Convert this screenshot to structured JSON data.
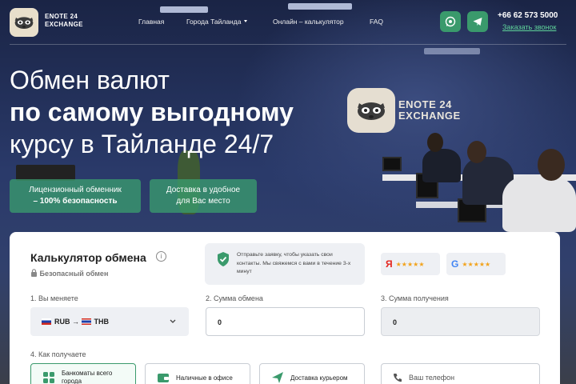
{
  "header": {
    "logo_text_line1": "ENOTE 24",
    "logo_text_line2": "EXCHANGE",
    "nav": {
      "home": "Главная",
      "cities": "Города Тайланда",
      "calculator": "Онлайн – калькулятор",
      "faq": "FAQ"
    },
    "phone": "+66 62 573 5000",
    "callback": "Заказать звонок"
  },
  "background": {
    "wall_logo_line1": "ENOTE 24",
    "wall_logo_line2": "EXCHANGE"
  },
  "hero": {
    "title_line1": "Обмен валют",
    "title_line2": "по самому выгодному",
    "title_line3": "курсу в Тайланде 24/7",
    "btn1_line1": "Лицензионный обменник",
    "btn1_line2": "– 100% безопасность",
    "btn2_line1": "Доставка в удобное",
    "btn2_line2": "для Вас место"
  },
  "calculator": {
    "title": "Калькулятор обмена",
    "info": "i",
    "safe": "Безопасный обмен",
    "notice": "Отправьте заявку, чтобы указать свои контакты. Мы свяжемся с вами в течение 3-х минут",
    "ratings": {
      "yandex": "Я",
      "google": "G",
      "stars": "★★★★★"
    },
    "step1_label": "1. Вы меняете",
    "step2_label": "2. Сумма обмена",
    "step3_label": "3. Сумма получения",
    "from_currency": "RUB",
    "arrow": "→",
    "to_currency": "THB",
    "amount": "0",
    "receive_amount": "0",
    "step4_label": "4. Как получаете",
    "options": {
      "atm": "Банкоматы всего города",
      "office": "Наличные в офисе",
      "courier": "Доставка курьером",
      "phone_placeholder": "Ваш телефон"
    }
  },
  "colors": {
    "accent": "#3a9a6c",
    "link": "#5fd39a"
  }
}
